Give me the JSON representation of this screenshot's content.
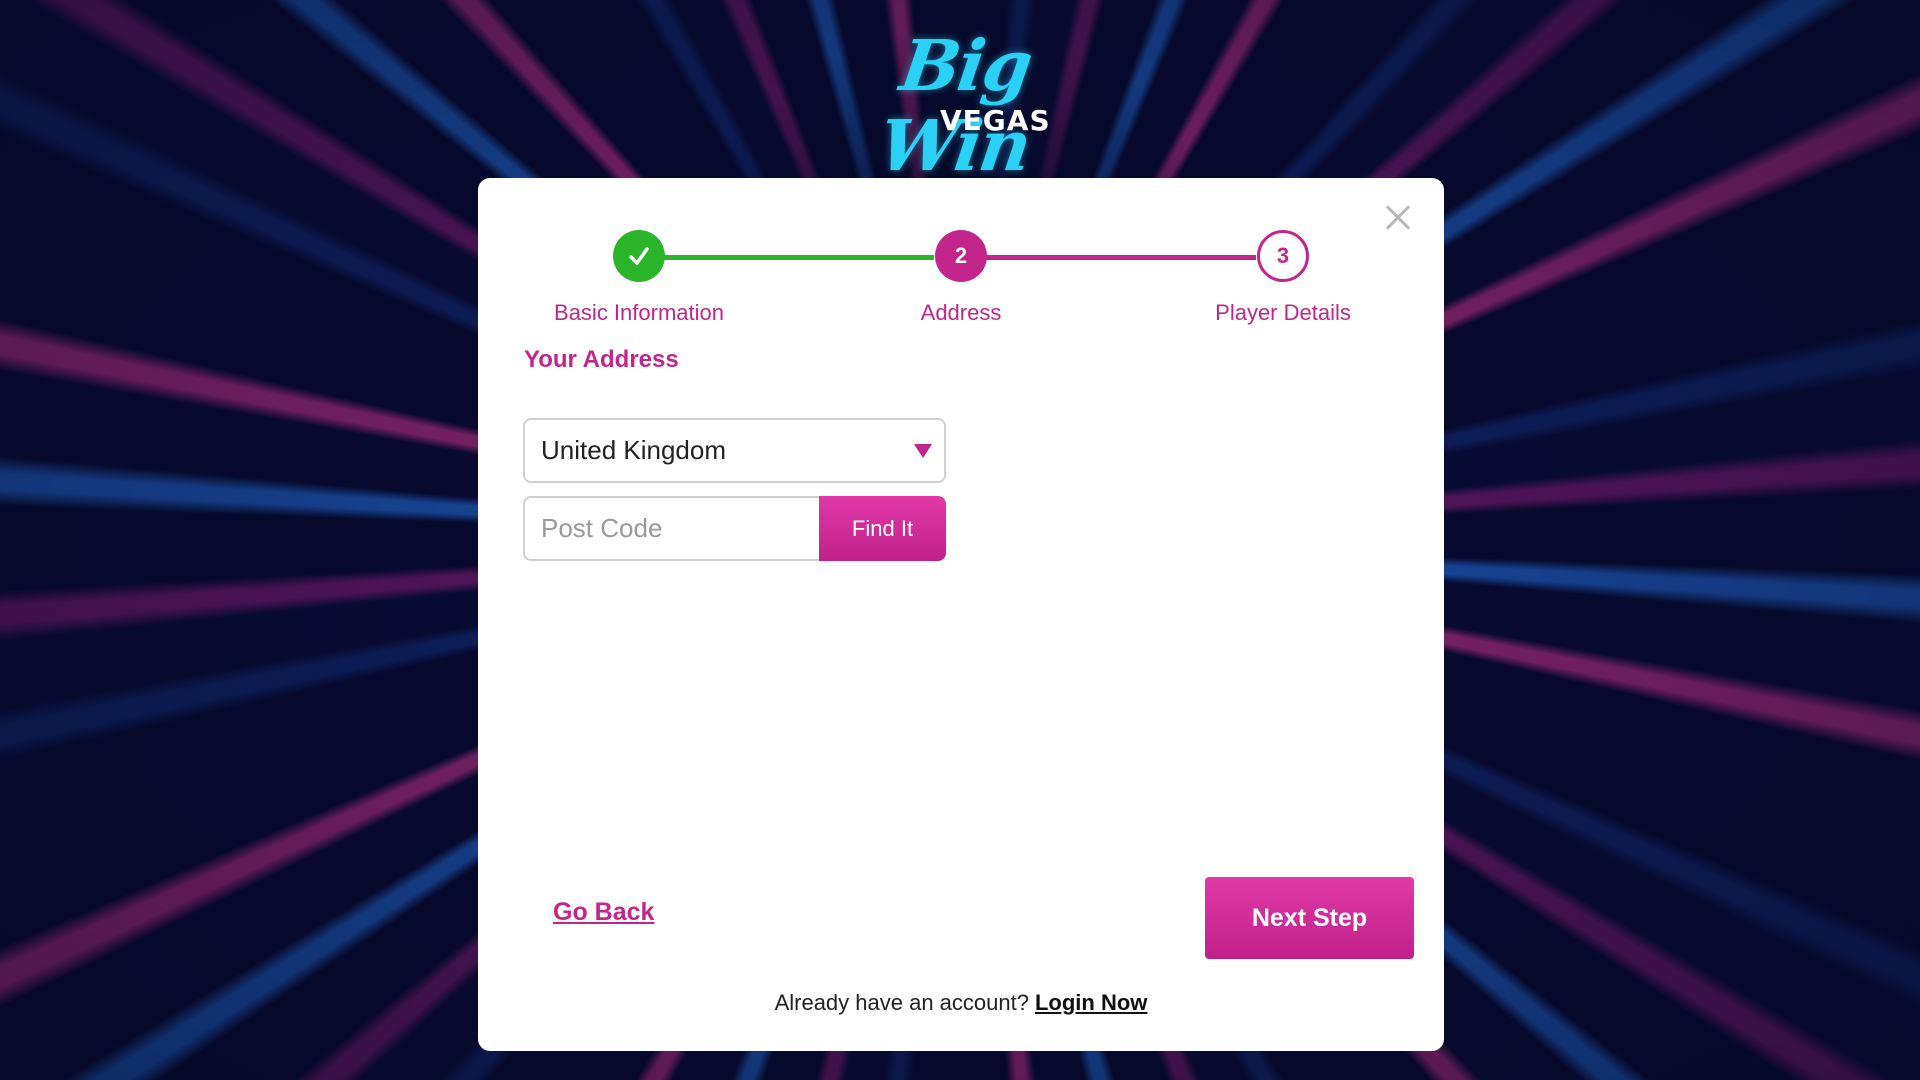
{
  "brand": {
    "logo_main": "Big Win",
    "logo_sub": "VEGAS",
    "colors": {
      "accent": "#c2268d",
      "success": "#2bb52b",
      "logo": "#2ad0f5"
    }
  },
  "modal": {
    "close_icon": "close-icon",
    "steps": [
      {
        "number": "",
        "label": "Basic Information",
        "status": "complete",
        "icon": "checkmark-icon"
      },
      {
        "number": "2",
        "label": "Address",
        "status": "current"
      },
      {
        "number": "3",
        "label": "Player Details",
        "status": "upcoming"
      }
    ],
    "section_title": "Your Address",
    "country_select": {
      "value": "United Kingdom"
    },
    "postcode": {
      "placeholder": "Post Code",
      "value": ""
    },
    "find_button": "Find It",
    "go_back": "Go Back",
    "next_step": "Next Step",
    "footer": {
      "prompt": "Already have an account?",
      "login_link": "Login Now"
    }
  }
}
